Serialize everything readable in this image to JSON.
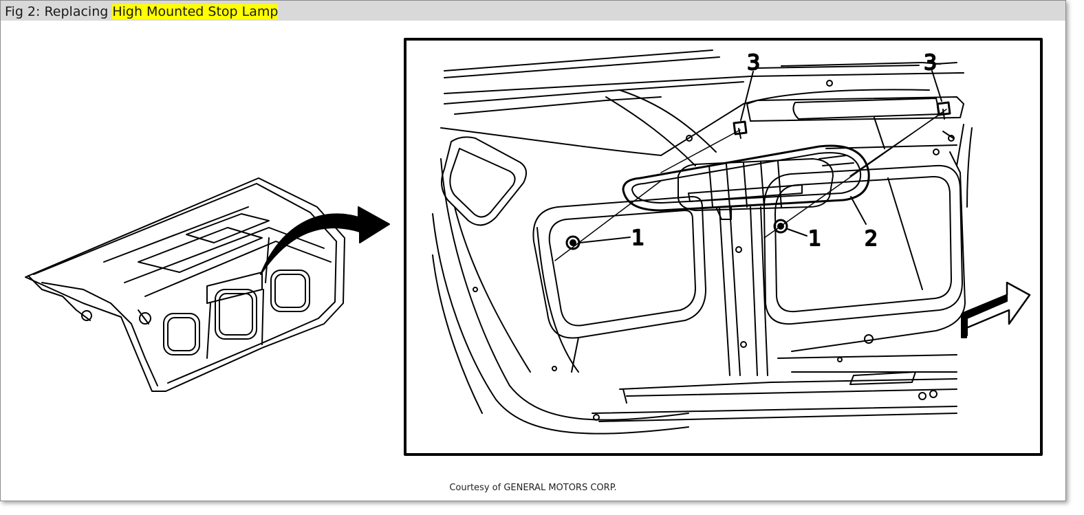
{
  "figure": {
    "caption_prefix": "Fig 2: Replacing ",
    "caption_highlight": "High Mounted Stop Lamp",
    "highlight_color": "#ffff00"
  },
  "callouts": {
    "nut_left": "1",
    "nut_right": "1",
    "lamp": "2",
    "screw_left": "3",
    "screw_right": "3"
  },
  "credit": "Courtesy of GENERAL MOTORS CORP."
}
